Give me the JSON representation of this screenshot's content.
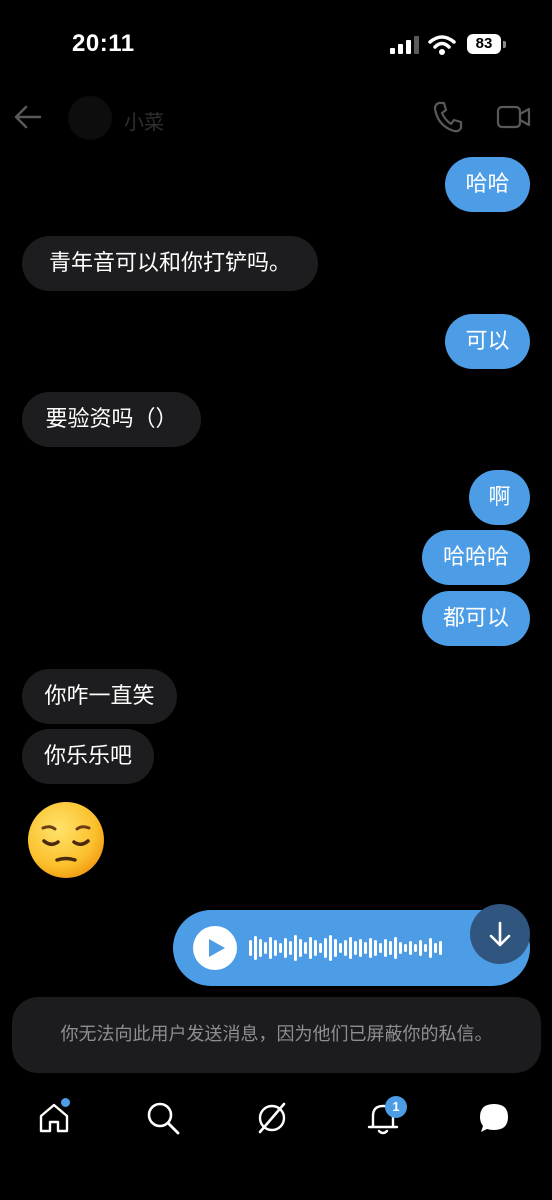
{
  "status_bar": {
    "time": "20:11",
    "battery": "83"
  },
  "header": {
    "contact_name": "小菜"
  },
  "messages": [
    {
      "dir": "out",
      "text": "哈哈"
    },
    {
      "dir": "in",
      "text": "青年音可以和你打铲吗。"
    },
    {
      "dir": "out",
      "text": "可以"
    },
    {
      "dir": "in",
      "text": "要验资吗（）"
    },
    {
      "dir": "out",
      "text": "啊"
    },
    {
      "dir": "out",
      "text": "哈哈哈"
    },
    {
      "dir": "out",
      "text": "都可以"
    },
    {
      "dir": "in",
      "text": "你咋一直笑"
    },
    {
      "dir": "in",
      "text": "你乐乐吧"
    }
  ],
  "emoji_message": "pensive-face",
  "voice_message": {
    "type": "audio"
  },
  "notice": "你无法向此用户发送消息，因为他们已屏蔽你的私信。",
  "tab_bar": {
    "items": [
      "home-icon",
      "search-icon",
      "communities-icon",
      "notifications-icon",
      "messages-icon"
    ],
    "notifications_badge": "1"
  },
  "colors": {
    "outgoing_bubble": "#4d9de6",
    "incoming_bubble": "#1d1d1f",
    "accent": "#4d9de6"
  }
}
